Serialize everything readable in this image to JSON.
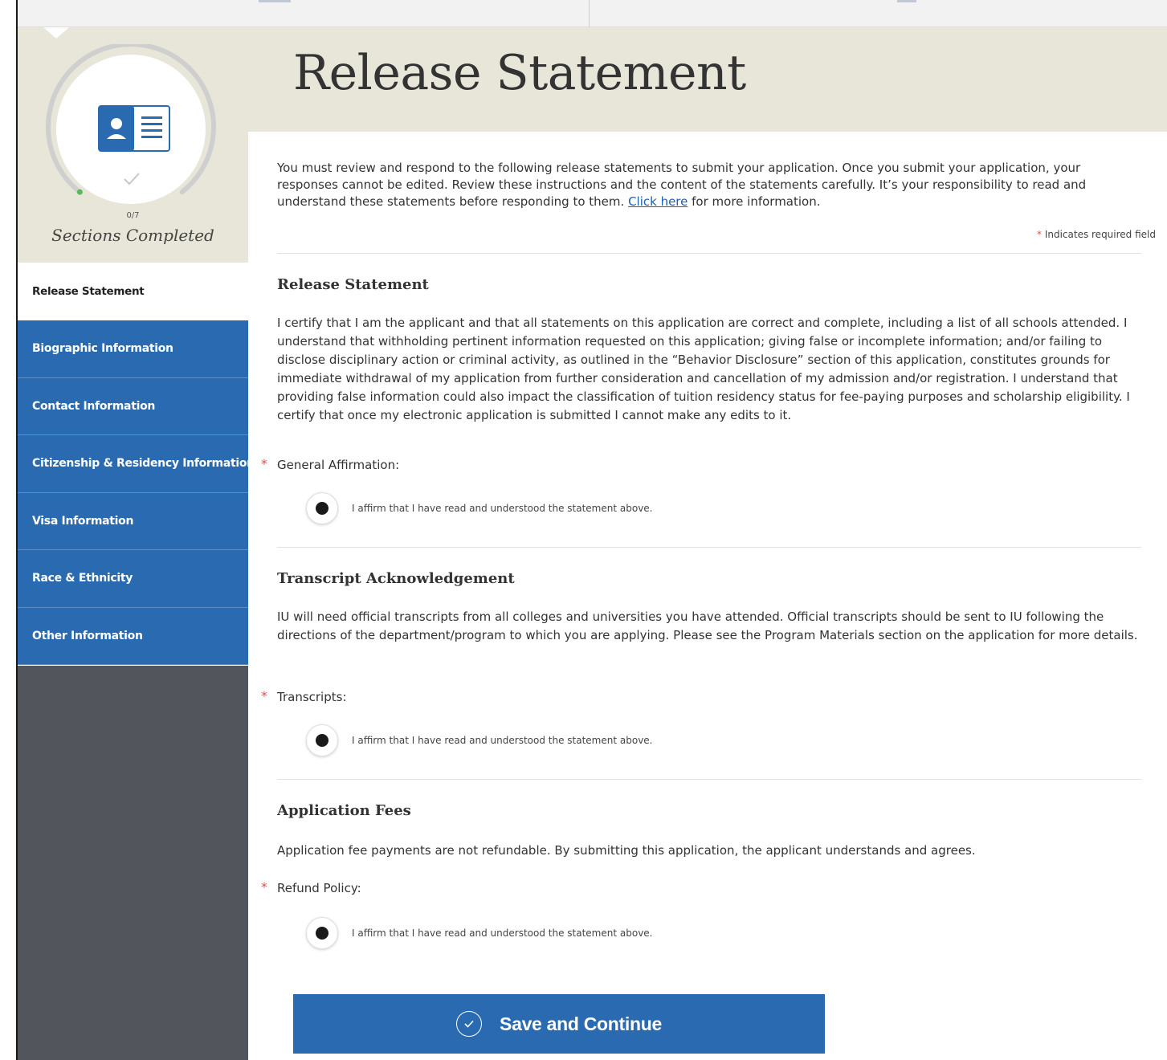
{
  "progress": {
    "count": "0/7",
    "label": "Sections Completed",
    "completed": 0,
    "total": 7
  },
  "nav": {
    "items": [
      {
        "label": "Release Statement",
        "active": true
      },
      {
        "label": "Biographic Information",
        "active": false
      },
      {
        "label": "Contact Information",
        "active": false
      },
      {
        "label": "Citizenship & Residency Information",
        "active": false
      },
      {
        "label": "Visa Information",
        "active": false
      },
      {
        "label": "Race & Ethnicity",
        "active": false
      },
      {
        "label": "Other Information",
        "active": false
      }
    ]
  },
  "header": {
    "title": "Release Statement"
  },
  "intro": {
    "text_before_link": "You must review and respond to the following release statements to submit your application. Once you submit your application, your responses cannot be edited. Review these instructions and the content of the statements carefully. It’s your responsibility to read and understand these statements before responding to them. ",
    "link_text": "Click here",
    "text_after_link": " for more information.",
    "required_note": "Indicates required field",
    "required_star": "*"
  },
  "sections": [
    {
      "title": "Release Statement",
      "body": "I certify that I am the applicant and that all statements on this application are correct and complete, including a list of all schools attended. I understand that withholding pertinent information requested on this application; giving false or incomplete information; and/or failing to disclose disciplinary action or criminal activity, as outlined in the “Behavior Disclosure” section of this application, constitutes grounds for immediate withdrawal of my application from further consideration and cancellation of my admission and/or registration. I understand that providing false information could also impact the classification of tuition residency status for fee-paying purposes and scholarship eligibility.  I certify that once my electronic application is submitted I cannot make any edits to it.",
      "field_label": "General Affirmation:",
      "option_label": "I affirm that I have read and understood the statement above.",
      "selected": true
    },
    {
      "title": "Transcript Acknowledgement",
      "body": "IU will need official transcripts from all colleges and universities you have attended. Official transcripts should be sent to IU following the directions of the department/program to which you are applying. Please see the Program Materials section on the application for more details.",
      "field_label": "Transcripts:",
      "option_label": "I affirm that I have read and understood the statement above.",
      "selected": true
    },
    {
      "title": "Application Fees",
      "body": "Application fee payments are not refundable. By submitting this application, the applicant understands and agrees.",
      "field_label": "Refund Policy:",
      "option_label": "I affirm that I have read and understood the statement above.",
      "selected": true
    }
  ],
  "actions": {
    "save_label": "Save and Continue"
  },
  "icons": {
    "profile": "profile-card-icon",
    "check": "check-icon",
    "save": "check-circle-icon"
  },
  "colors": {
    "primary_blue": "#2a6ab0",
    "beige": "#e8e6d8",
    "sidebar_dark": "#52565c",
    "required_red": "#d9534f",
    "progress_green": "#5cb85c"
  }
}
